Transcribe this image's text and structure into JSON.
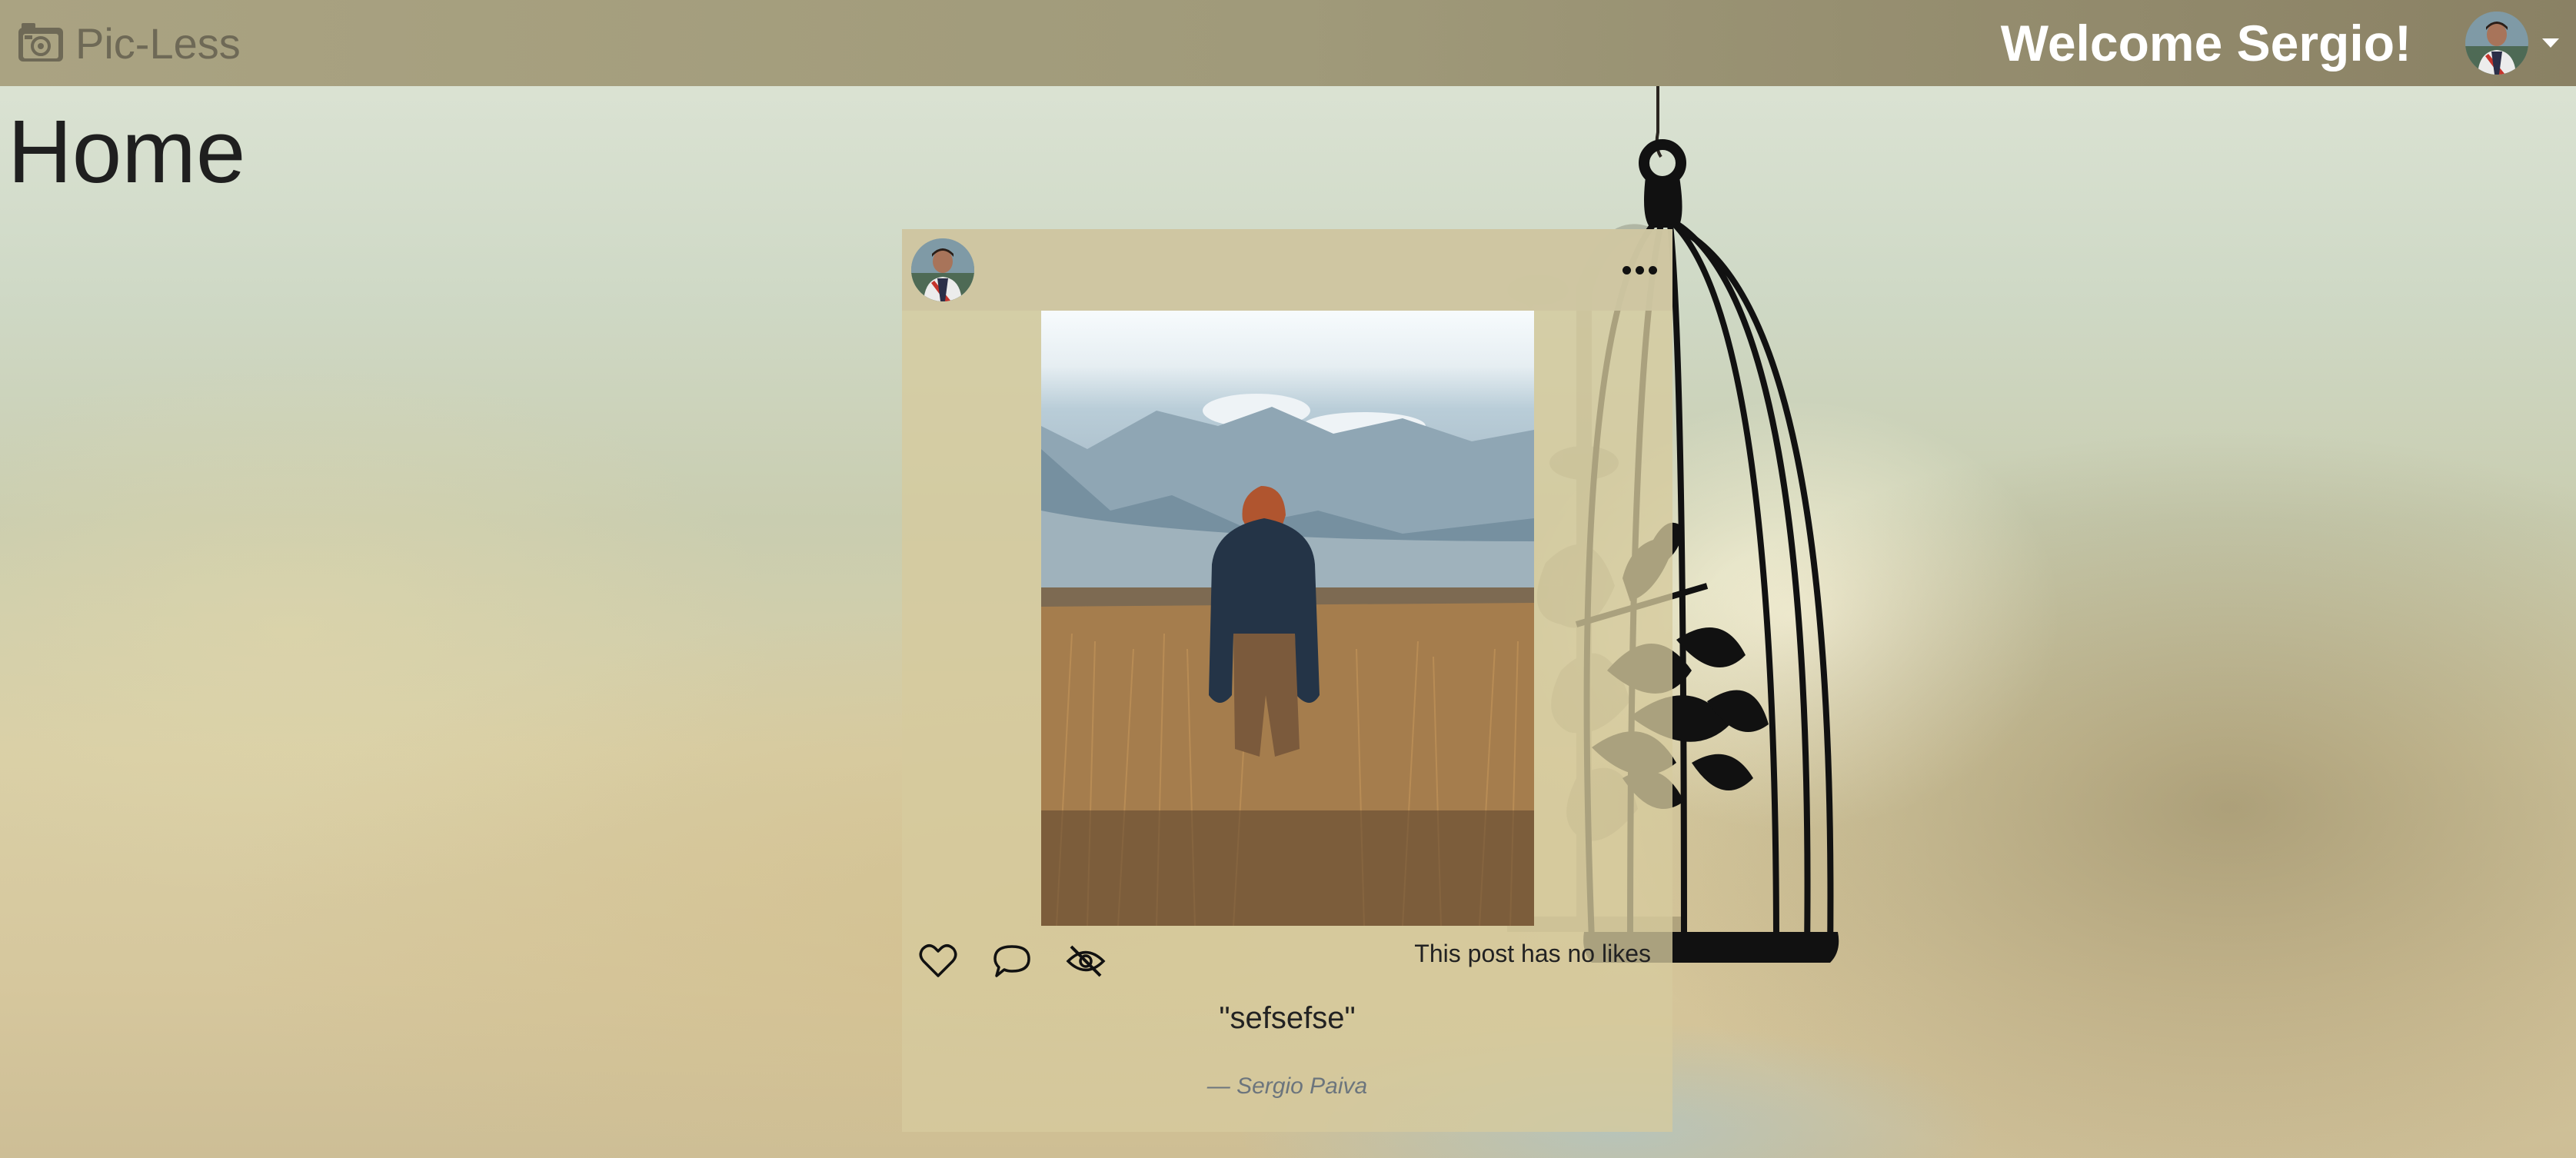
{
  "app": {
    "brand_name": "Pic-Less",
    "brand_icon": "camera-icon"
  },
  "header": {
    "welcome_text": "Welcome Sergio!",
    "user_menu_icon": "caret-down-icon"
  },
  "page": {
    "title": "Home"
  },
  "post": {
    "menu_icon": "more-horizontal-icon",
    "likes_text": "This post has no likes",
    "caption": "\"sefsefse\"",
    "author": "— Sergio Paiva",
    "actions": [
      {
        "name": "like",
        "icon": "heart-icon"
      },
      {
        "name": "comment",
        "icon": "speech-bubble-icon"
      },
      {
        "name": "hide",
        "icon": "eye-slash-icon"
      }
    ]
  },
  "colors": {
    "navbar": "#a09a7a",
    "brand_text": "#6e6956",
    "card_background": "#d6cb9e",
    "author_text": "#6c757d"
  }
}
